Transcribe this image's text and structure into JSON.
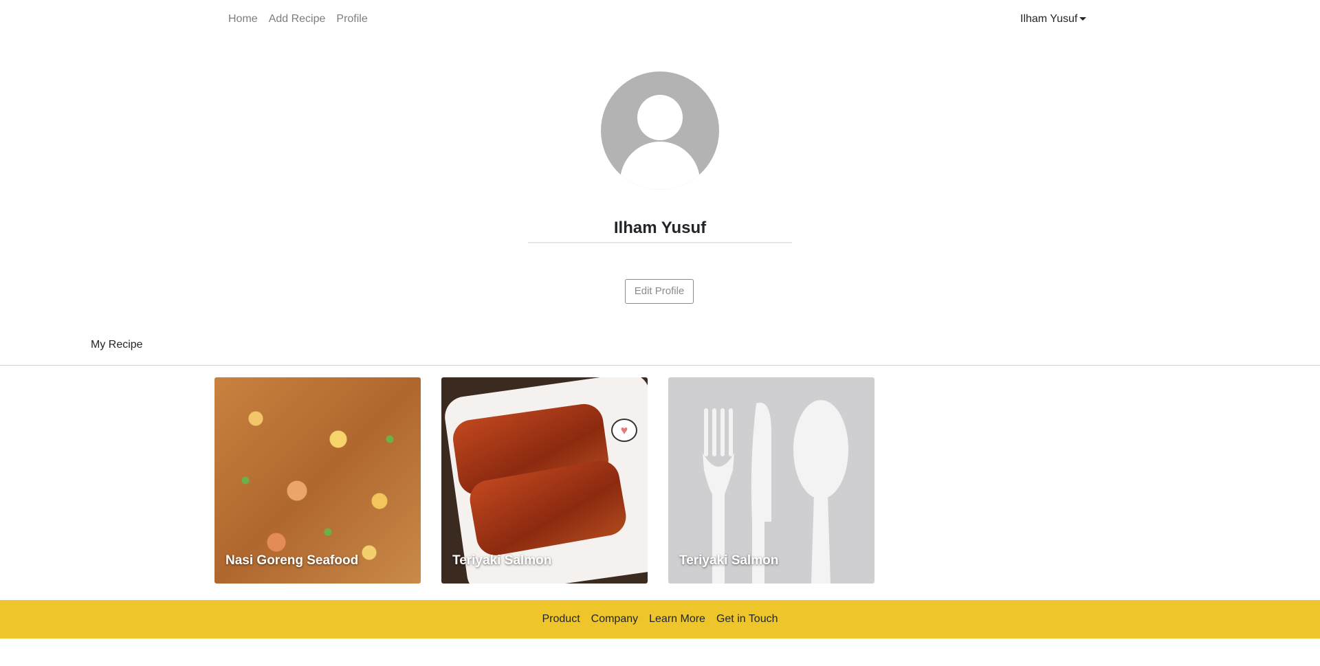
{
  "nav": {
    "links": [
      "Home",
      "Add Recipe",
      "Profile"
    ],
    "user_name": "Ilham Yusuf"
  },
  "profile": {
    "name": "Ilham Yusuf",
    "edit_button": "Edit Profile"
  },
  "section": {
    "title": "My Recipe"
  },
  "recipes": [
    {
      "title": "Nasi Goreng Seafood",
      "image": "fried-rice-photo"
    },
    {
      "title": "Teriyaki Salmon",
      "image": "salmon-photo"
    },
    {
      "title": "Teriyaki Salmon",
      "image": "placeholder-utensils"
    }
  ],
  "footer": {
    "links": [
      "Product",
      "Company",
      "Learn More",
      "Get in Touch"
    ]
  },
  "colors": {
    "footer_bg": "#eec62c",
    "avatar_bg": "#b3b3b3",
    "placeholder_bg": "#cfcfd1"
  }
}
